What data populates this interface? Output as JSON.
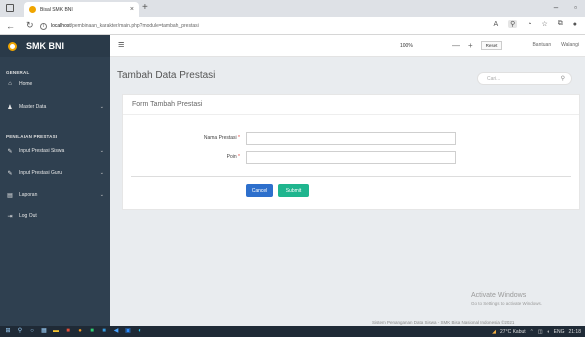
{
  "browser": {
    "tab_title": "Bisal SMK BNI",
    "url_host": "localhost",
    "url_path": "/pembinaan_karakter/main.php?module=tambah_prestasi",
    "zoom": "100%",
    "reset_label": "Reset",
    "minus": "—",
    "plus": "+"
  },
  "sidebar": {
    "brand": "SMK BNI",
    "section_general": "GENERAL",
    "section_prestasi": "PENILAIAN PRESTASI",
    "items": [
      {
        "label": "Home",
        "icon": "home-icon"
      },
      {
        "label": "Master Data",
        "icon": "users-icon"
      },
      {
        "label": "Input Prestasi Siswa",
        "icon": "edit-icon"
      },
      {
        "label": "Input Prestasi Guru",
        "icon": "edit-icon"
      },
      {
        "label": "Laporan",
        "icon": "report-icon"
      },
      {
        "label": "Log Out",
        "icon": "logout-icon"
      }
    ]
  },
  "topbar": {
    "bantuan": "Bantuan",
    "user": "Walangi"
  },
  "page": {
    "title": "Tambah Data Prestasi",
    "search_placeholder": "Cari..."
  },
  "form": {
    "title": "Form Tambah Prestasi",
    "field1_label": "Nama Prestasi",
    "field2_label": "Poin",
    "required_mark": "*",
    "field1_value": "",
    "field2_value": "",
    "cancel_label": "Cancel",
    "submit_label": "Submit"
  },
  "watermark": {
    "line1": "Activate Windows",
    "line2": "Go to Settings to activate Windows."
  },
  "footer": "Sistem Penanganan Data Siswa - SMK Bisa Nasional Indonesia ©2021",
  "taskbar": {
    "weather": "27°C Kabut",
    "lang": "ENG",
    "time": "21:18"
  }
}
